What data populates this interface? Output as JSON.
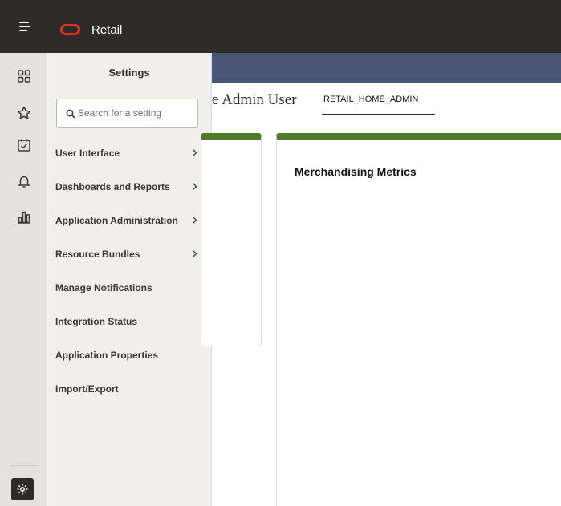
{
  "app": {
    "name": "Retail"
  },
  "colors": {
    "topbar": "#2e2b28",
    "brand_logo": "#e0301e",
    "banner": "#4b5577",
    "card_accent": "#4e7a2a",
    "panel_bg": "#f1efed",
    "rail_bg": "#e4e2de"
  },
  "rail": {
    "icons": [
      "dashboard-grid-icon",
      "star-icon",
      "task-checkbox-icon",
      "bell-icon",
      "bar-chart-icon",
      "settings-gear-icon"
    ]
  },
  "settings_panel": {
    "title": "Settings",
    "search": {
      "placeholder": "Search for a setting",
      "value": ""
    },
    "items": [
      {
        "label": "User Interface",
        "has_submenu": true
      },
      {
        "label": "Dashboards and Reports",
        "has_submenu": true
      },
      {
        "label": "Application Administration",
        "has_submenu": true
      },
      {
        "label": "Resource Bundles",
        "has_submenu": true
      },
      {
        "label": "Manage Notifications",
        "has_submenu": false
      },
      {
        "label": "Integration Status",
        "has_submenu": false
      },
      {
        "label": "Application Properties",
        "has_submenu": false
      },
      {
        "label": "Import/Export",
        "has_submenu": false
      }
    ]
  },
  "main": {
    "heading": "e Admin User",
    "role_tab": "RETAIL_HOME_ADMIN",
    "cards": [
      {
        "title": "Merchandising Metrics"
      }
    ]
  }
}
